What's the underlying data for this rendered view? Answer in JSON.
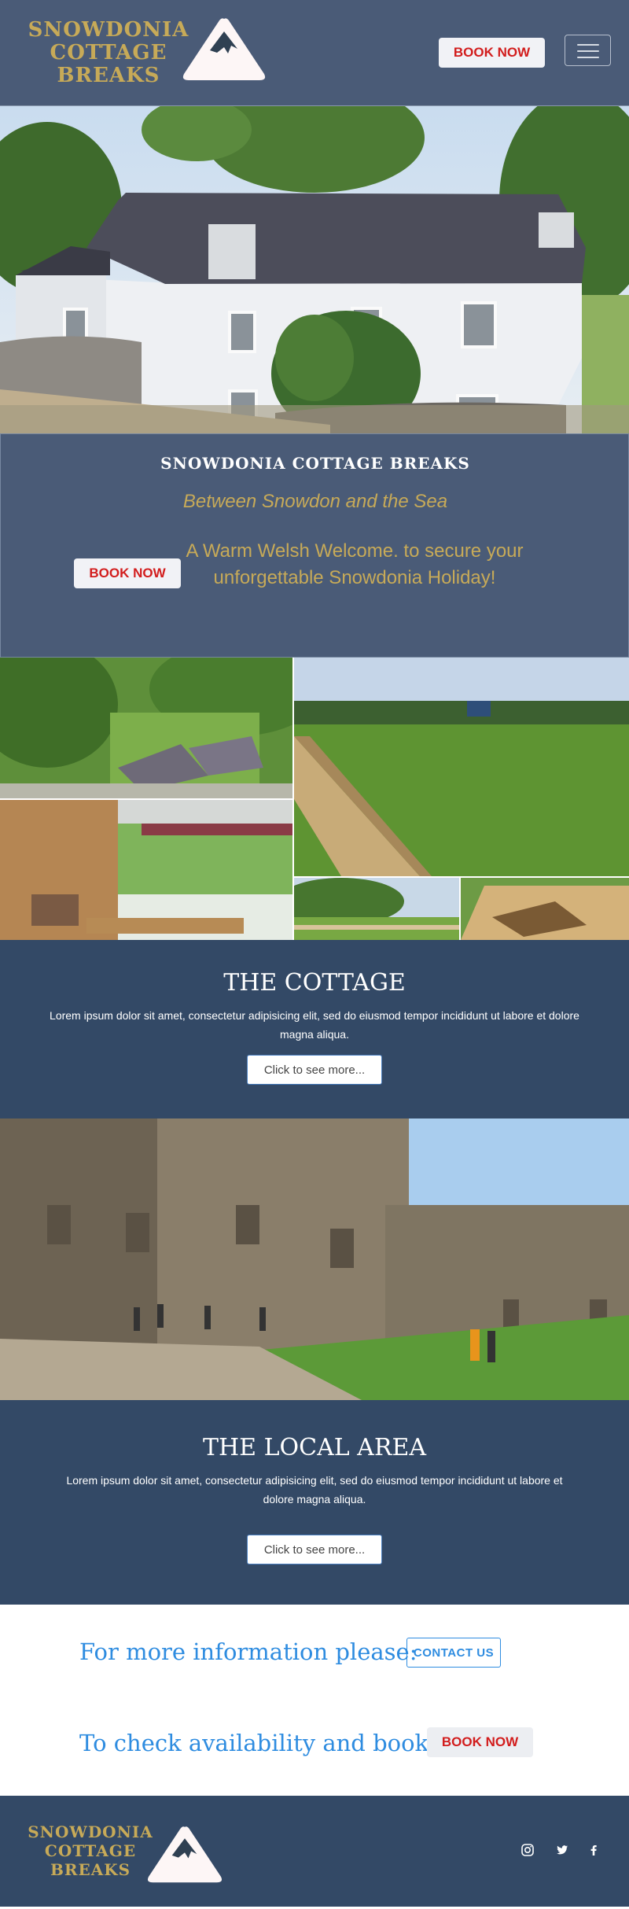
{
  "brand": {
    "name_lines": [
      "SNOWDONIA",
      "COTTAGE",
      "BREAKS"
    ]
  },
  "nav": {
    "book_label": "BOOK NOW"
  },
  "welcome": {
    "title": "SNOWDONIA COTTAGE BREAKS",
    "subtitle": "Between Snowdon and the Sea",
    "book_label": "BOOK NOW",
    "text": "A Warm Welsh Welcome. to secure your unforgettable Snowdonia Holiday!"
  },
  "cottage": {
    "title": "THE COTTAGE",
    "text": "Lorem ipsum dolor sit amet, consectetur adipisicing elit, sed do eiusmod tempor incididunt ut labore et dolore magna aliqua.",
    "button": "Click to see more..."
  },
  "local_area": {
    "title": "THE LOCAL AREA",
    "text": "Lorem ipsum dolor sit amet, consectetur adipisicing elit, sed do eiusmod tempor incididunt ut labore et dolore magna aliqua.",
    "button": "Click to see more..."
  },
  "info": {
    "more_info": "For more information please:",
    "contact_label": "CONTACT US",
    "availability": "To check availability and book:",
    "book_label": "BOOK NOW"
  },
  "footer": {
    "brand_lines": [
      "SNOWDONIA",
      "COTTAGE",
      "BREAKS"
    ],
    "social_icons": [
      "instagram-icon",
      "twitter-icon",
      "facebook-icon"
    ]
  },
  "colors": {
    "nav_bg": "#4a5b77",
    "section_bg": "#334966",
    "gold": "#c7aa58",
    "book_red": "#d21d1d",
    "link_blue": "#2e8ce0"
  }
}
